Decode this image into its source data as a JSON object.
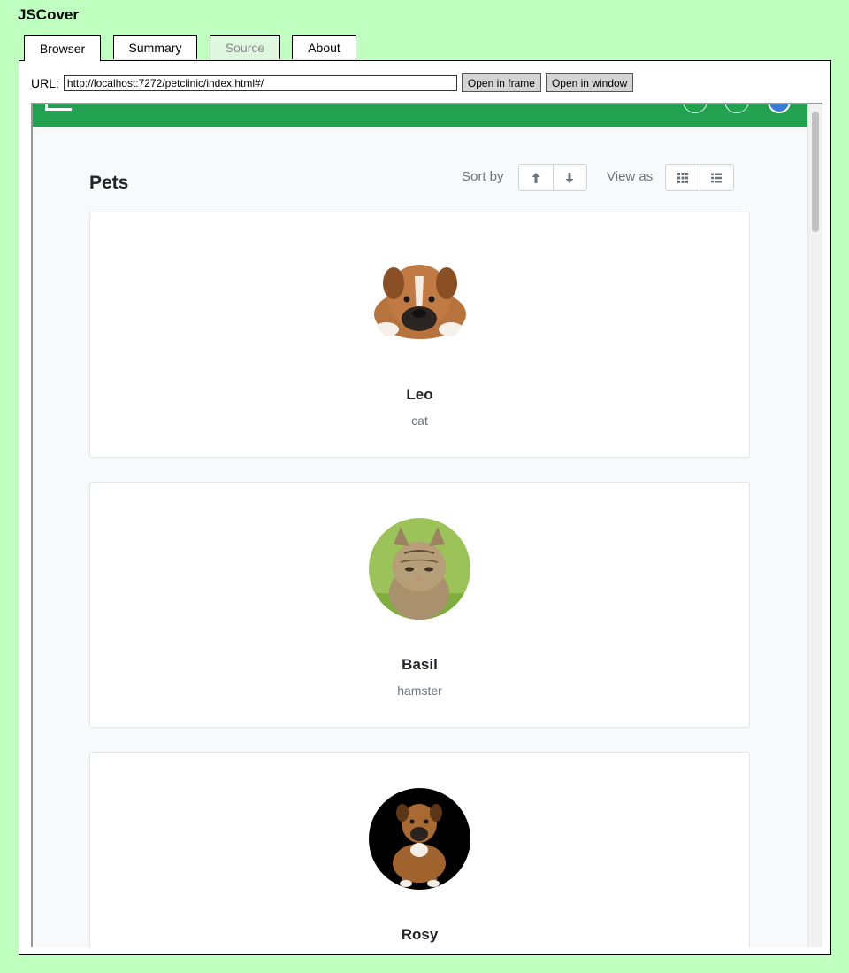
{
  "app": {
    "title": "JSCover"
  },
  "tabs": [
    {
      "label": "Browser",
      "active": true
    },
    {
      "label": "Summary"
    },
    {
      "label": "Source",
      "disabled": true
    },
    {
      "label": "About"
    }
  ],
  "url_bar": {
    "label": "URL:",
    "value": "http://localhost:7272/petclinic/index.html#/",
    "open_frame_label": "Open in frame",
    "open_window_label": "Open in window"
  },
  "frame": {
    "header_color": "#22a150",
    "title": "Pets",
    "sort_label": "Sort by",
    "view_label": "View as",
    "sort_up_icon": "arrow-up-icon",
    "sort_down_icon": "arrow-down-icon",
    "grid_view_icon": "grid-icon",
    "list_view_icon": "list-icon",
    "pets": [
      {
        "name": "Leo",
        "type": "cat",
        "image": "boxer-dog-lying-photo"
      },
      {
        "name": "Basil",
        "type": "hamster",
        "image": "tabby-kitten-photo"
      },
      {
        "name": "Rosy",
        "type": "",
        "image": "boxer-puppy-photo"
      }
    ]
  },
  "colors": {
    "page_bg": "#bfffbf",
    "accent": "#22a150"
  }
}
